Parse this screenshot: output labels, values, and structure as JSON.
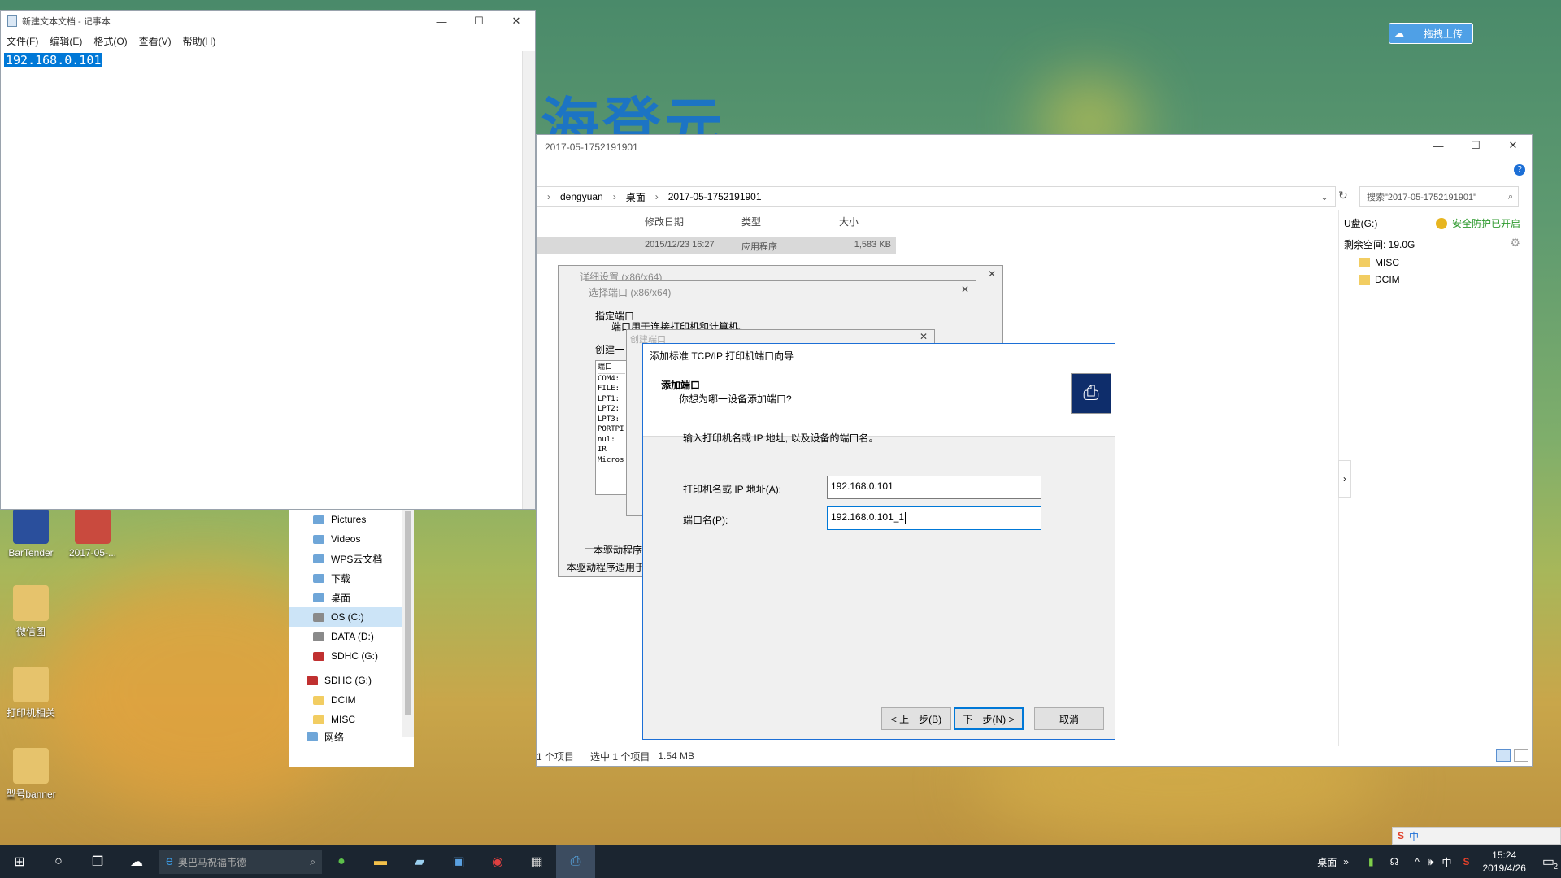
{
  "desktop": {
    "baidu_upload_button": "拖拽上传",
    "banner_text": "海登元",
    "icons": [
      {
        "label": "BarTender"
      },
      {
        "label": "2017-05-..."
      },
      {
        "label": "微信图"
      },
      {
        "label": "打印机相关"
      },
      {
        "label": "型号banner"
      }
    ]
  },
  "notepad": {
    "title": "新建文本文档 - 记事本",
    "menu": [
      "文件(F)",
      "编辑(E)",
      "格式(O)",
      "查看(V)",
      "帮助(H)"
    ],
    "content": "192.168.0.101"
  },
  "explorer": {
    "title": "2017-05-1752191901",
    "breadcrumb": [
      "dengyuan",
      "桌面",
      "2017-05-1752191901"
    ],
    "search_placeholder": "搜索\"2017-05-1752191901\"",
    "columns": [
      "修改日期",
      "类型",
      "大小"
    ],
    "file_row": {
      "date": "2015/12/23 16:27",
      "type": "应用程序",
      "size": "1,583 KB"
    },
    "status": {
      "count": "1 个项目",
      "selected": "选中 1 个项目",
      "size": "1.54 MB"
    },
    "right_panel": {
      "drive": "U盘(G:)",
      "protection": "安全防护已开启",
      "free_space": "剩余空间: 19.0G",
      "folders": [
        "MISC",
        "DCIM"
      ]
    },
    "nav_items": [
      {
        "label": "Pictures"
      },
      {
        "label": "Videos"
      },
      {
        "label": "WPS云文档"
      },
      {
        "label": "下载"
      },
      {
        "label": "桌面"
      },
      {
        "label": "OS (C:)"
      },
      {
        "label": "DATA (D:)"
      },
      {
        "label": "SDHC (G:)"
      },
      {
        "label": "SDHC (G:)"
      },
      {
        "label": "DCIM"
      },
      {
        "label": "MISC"
      },
      {
        "label": "网络"
      }
    ]
  },
  "back_dialogs": {
    "d1_title": "详细设置 (x86/x64)",
    "d2_title": "选择端口 (x86/x64)",
    "d2_heading": "指定端口",
    "d2_desc": "端口用于连接打印机和计算机。",
    "d2_label1": "指",
    "d2_create": "创建一",
    "d3_title": "创建端口",
    "port_list": [
      "端口",
      "COM4:",
      "FILE:",
      "LPT1:",
      "LPT2:",
      "LPT3:",
      "PORTPI",
      "nul:",
      "IR",
      "Micros"
    ],
    "driver_text1": "本驱动程序",
    "driver_text2": "本驱动程序适用于"
  },
  "wizard": {
    "title": "添加标准 TCP/IP 打印机端口向导",
    "heading": "添加端口",
    "subheading": "你想为哪一设备添加端口?",
    "instruction": "输入打印机名或 IP 地址, 以及设备的端口名。",
    "ip_label": "打印机名或 IP 地址(A):",
    "ip_value": "192.168.0.101",
    "port_label": "端口名(P):",
    "port_value": "192.168.0.101_1",
    "back_button": "< 上一步(B)",
    "next_button": "下一步(N) >",
    "cancel_button": "取消"
  },
  "taskbar": {
    "search_placeholder": "奥巴马祝福韦德",
    "desktop_label": "桌面",
    "ime": "中",
    "time": "15:24",
    "date": "2019/4/26",
    "notification_count": "2"
  }
}
